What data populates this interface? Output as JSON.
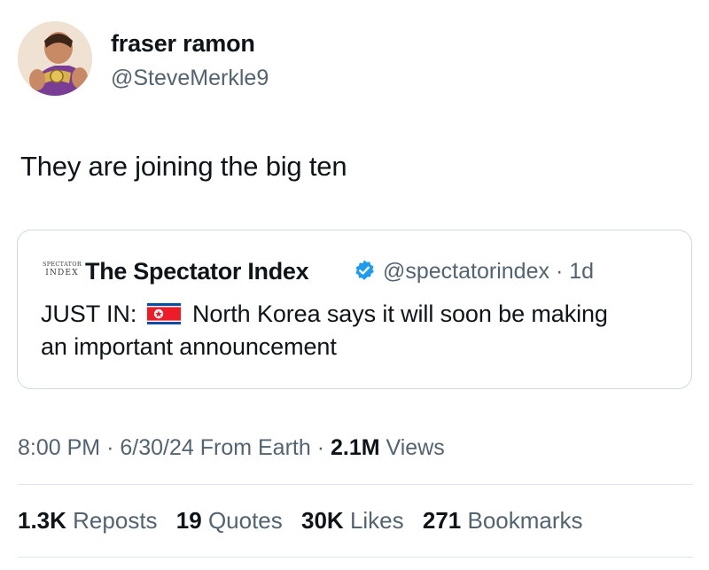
{
  "author": {
    "display_name": "fraser ramon",
    "handle": "@SteveMerkle9"
  },
  "tweet": {
    "text": "They are joining the big ten"
  },
  "quoted": {
    "logo_text": {
      "top": "SPECTATOR",
      "bottom": "INDEX"
    },
    "name": "The Spectator Index",
    "verified_icon": "verified-badge-icon",
    "handle": "@spectatorindex",
    "separator": "·",
    "age": "1d",
    "text_prefix": "JUST IN:",
    "flag_icon": "north-korea-flag-icon",
    "text_line1": "North Korea says it will soon be making",
    "text_line2": "an important announcement"
  },
  "meta": {
    "time": "8:00 PM",
    "sep1": "·",
    "date": "6/30/24",
    "source": "From Earth",
    "sep2": "·",
    "views_count": "2.1M",
    "views_label": "Views"
  },
  "stats": {
    "reposts_count": "1.3K",
    "reposts_label": "Reposts",
    "quotes_count": "19",
    "quotes_label": "Quotes",
    "likes_count": "30K",
    "likes_label": "Likes",
    "bookmarks_count": "271",
    "bookmarks_label": "Bookmarks"
  },
  "colors": {
    "text_primary": "#0f1419",
    "text_secondary": "#536471",
    "verified_blue": "#1d9bf0",
    "border": "#cfd9de"
  }
}
